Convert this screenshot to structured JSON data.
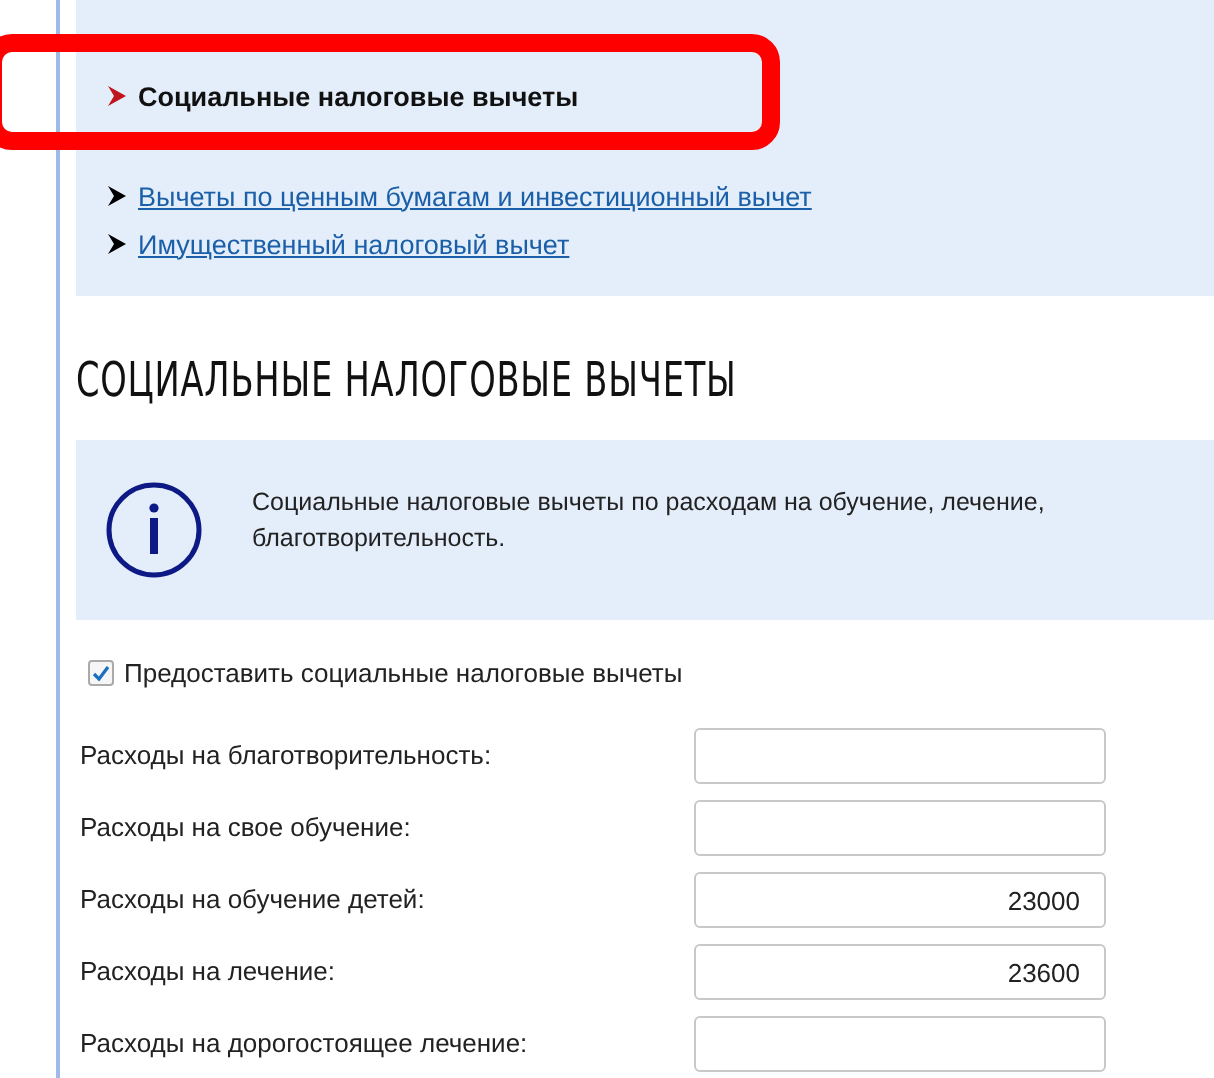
{
  "nav": {
    "items": [
      {
        "label": "Социальные налоговые вычеты",
        "selected": true,
        "highlighted": true
      },
      {
        "label": "Вычеты по ценным бумагам и инвестиционный вычет",
        "selected": false,
        "highlighted": false
      },
      {
        "label": "Имущественный налоговый вычет",
        "selected": false,
        "highlighted": false
      }
    ]
  },
  "heading": "СОЦИАЛЬНЫЕ НАЛОГОВЫЕ ВЫЧЕТЫ",
  "info": {
    "text": "Социальные налоговые вычеты по расходам на обучение, лечение, благотворительность."
  },
  "consent": {
    "label": "Предоставить социальные налоговые вычеты",
    "checked": true
  },
  "fields": [
    {
      "label": "Расходы на благотворительность:"
    },
    {
      "label": "Расходы на свое обучение:"
    },
    {
      "label": "Расходы на обучение детей:",
      "value": "23000"
    },
    {
      "label": "Расходы на лечение:",
      "value": "23600"
    },
    {
      "label": "Расходы на дорогостоящее лечение:"
    }
  ]
}
